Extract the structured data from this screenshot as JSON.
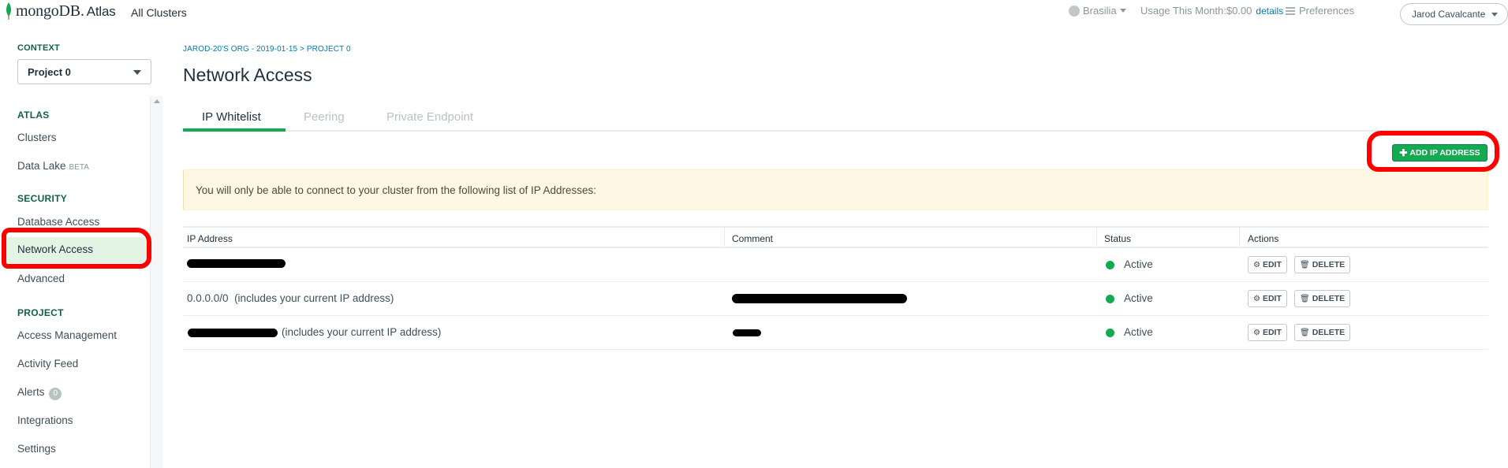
{
  "topbar": {
    "logo_text": "mongoDB.",
    "logo_sub": "Atlas",
    "all_clusters": "All Clusters",
    "region": "Brasilia",
    "usage_label": "Usage This Month:",
    "usage_value": "$0.00",
    "details_link": "details",
    "preferences": "Preferences",
    "user": "Jarod Cavalcante"
  },
  "sidebar": {
    "context_label": "CONTEXT",
    "project_value": "Project 0",
    "sections": {
      "atlas": "ATLAS",
      "security": "SECURITY",
      "project": "PROJECT"
    },
    "items": {
      "clusters": "Clusters",
      "data_lake": "Data Lake",
      "data_lake_badge": "BETA",
      "database_access": "Database Access",
      "network_access": "Network Access",
      "advanced": "Advanced",
      "access_management": "Access Management",
      "activity_feed": "Activity Feed",
      "alerts": "Alerts",
      "alerts_count": "0",
      "integrations": "Integrations",
      "settings": "Settings"
    }
  },
  "main": {
    "breadcrumb": "JAROD-20'S ORG - 2019-01-15 > PROJECT 0",
    "title": "Network Access",
    "tabs": [
      "IP Whitelist",
      "Peering",
      "Private Endpoint"
    ],
    "active_tab": "IP Whitelist",
    "add_ip_button": "ADD IP ADDRESS",
    "notice": "You will only be able to connect to your cluster from the following list of IP Addresses:",
    "table": {
      "headers": [
        "IP Address",
        "Comment",
        "Status",
        "Actions"
      ],
      "rows": [
        {
          "ip": "",
          "ip_note": "",
          "comment": "",
          "status": "Active"
        },
        {
          "ip": "0.0.0.0/0",
          "ip_note": "(includes your current IP address)",
          "comment": "",
          "status": "Active"
        },
        {
          "ip": "",
          "ip_note": "(includes your current IP address)",
          "comment": "",
          "status": "Active"
        }
      ],
      "edit_label": "EDIT",
      "delete_label": "DELETE"
    }
  },
  "colors": {
    "brand_green": "#13aa52",
    "link_blue": "#007cad",
    "annotation_red": "#ff0000"
  }
}
